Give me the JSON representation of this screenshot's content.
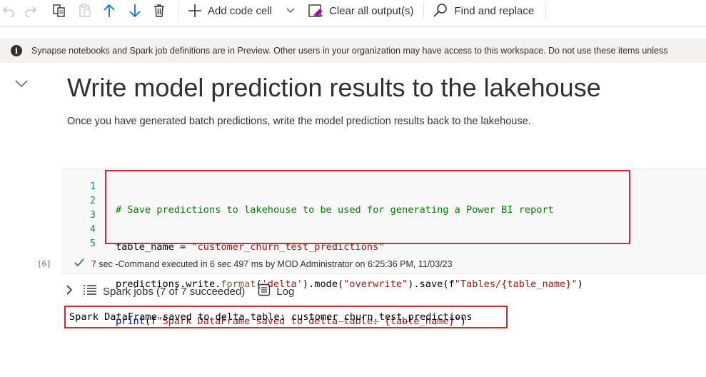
{
  "toolbar": {
    "add_code_cell_label": "Add code cell",
    "clear_outputs_label": "Clear all output(s)",
    "find_replace_label": "Find and replace"
  },
  "banner": {
    "message": "Synapse notebooks and Spark job definitions are in Preview. Other users in your organization may have access to this workspace. Do not use these items unless"
  },
  "markdown_cell": {
    "title": "Write model prediction results to the lakehouse",
    "description": "Once you have generated batch predictions, write the model prediction results back to the lakehouse."
  },
  "code_cell": {
    "line_numbers": [
      "1",
      "2",
      "3",
      "4",
      "5"
    ],
    "execution_count": "[6]",
    "status": "7 sec -Command executed in 6 sec 497 ms by MOD Administrator on 6:25:36 PM, 11/03/23",
    "spark_jobs_label": "Spark jobs (7 of 7 succeeded)",
    "log_label": "Log",
    "output_text": "Spark DataFrame saved to delta table: customer_churn_test_predictions"
  },
  "code_tokens": {
    "l1_comment": "# Save predictions to lakehouse to be used for generating a Power BI report",
    "l2_a": "table_name = ",
    "l2_str": "\"customer_churn_test_predictions\"",
    "l3_a": "predictions.write.",
    "l3_fn1": "format",
    "l3_b": "(",
    "l3_str1": "'delta'",
    "l3_c": ").mode(",
    "l3_str2": "\"overwrite\"",
    "l3_d": ").save(f",
    "l3_str3": "\"Tables/{table_name}\"",
    "l3_e": ")",
    "l4_fn": "print",
    "l4_a": "(f",
    "l4_str": "\"Spark DataFrame saved to delta table: {table_name}\"",
    "l4_b": ")"
  },
  "colors": {
    "highlight_border": "#d8262f",
    "accent_blue": "#0078d4",
    "success_green": "#107c10"
  }
}
